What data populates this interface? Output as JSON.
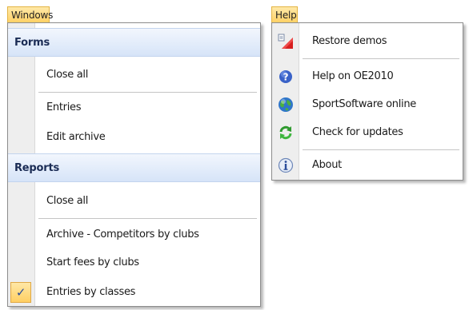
{
  "menubar": {
    "windows_label": "Windows",
    "help_label": "Help"
  },
  "windows_menu": {
    "forms_header": "Forms",
    "forms_items": [
      "Close all",
      "Entries",
      "Edit archive"
    ],
    "reports_header": "Reports",
    "reports_items": [
      "Close all",
      "Archive - Competitors by clubs",
      "Start fees by clubs",
      "Entries by classes"
    ],
    "checked_item": "Entries by classes",
    "check_glyph": "✓"
  },
  "help_menu": {
    "items": [
      {
        "label": "Restore demos",
        "icon": "restore-icon"
      },
      {
        "label": "Help on OE2010",
        "icon": "help-icon"
      },
      {
        "label": "SportSoftware online",
        "icon": "globe-icon"
      },
      {
        "label": "Check for updates",
        "icon": "refresh-icon"
      },
      {
        "label": "About",
        "icon": "info-icon"
      }
    ]
  },
  "colors": {
    "tab_highlight": "#ffd166",
    "section_header": "#d6e4f8",
    "gutter": "#eeeeee"
  }
}
